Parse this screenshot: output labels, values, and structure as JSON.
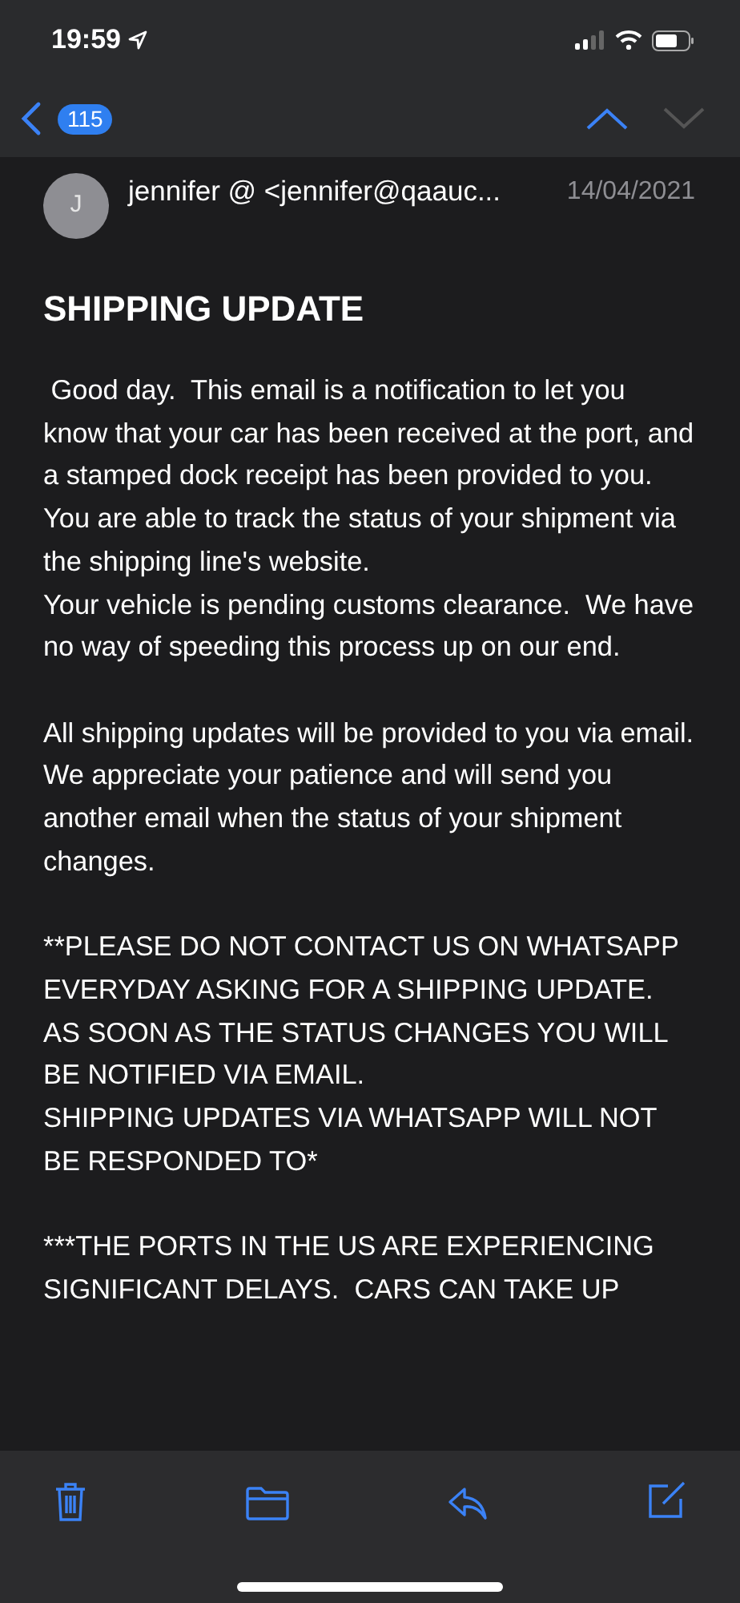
{
  "status_bar": {
    "time": "19:59"
  },
  "nav": {
    "unread_count": "115"
  },
  "message": {
    "avatar_initial": "J",
    "sender": "jennifer @ <jennifer@qaauc...",
    "date": "14/04/2021",
    "subject": "SHIPPING UPDATE",
    "body_blocks": [
      [
        " Good day.  This email is a notification to let you know that your car has been received at the port, and a stamped dock receipt has been provided to you.",
        "You are able to track the status of your shipment via the shipping line's website.",
        "Your vehicle is pending customs clearance.  We have no way of speeding this process up on our end."
      ],
      [
        "All shipping updates will be provided to you via email.   We appreciate your patience and will send you another email when the status of your shipment changes."
      ],
      [
        "**PLEASE DO NOT CONTACT US ON WHATSAPP EVERYDAY ASKING FOR A SHIPPING UPDATE.  AS SOON AS THE STATUS CHANGES YOU WILL BE NOTIFIED VIA EMAIL.",
        "SHIPPING UPDATES VIA WHATSAPP WILL NOT BE RESPONDED TO*"
      ],
      [
        "***THE PORTS IN THE US ARE EXPERIENCING SIGNIFICANT DELAYS.  CARS CAN TAKE UP"
      ]
    ]
  }
}
